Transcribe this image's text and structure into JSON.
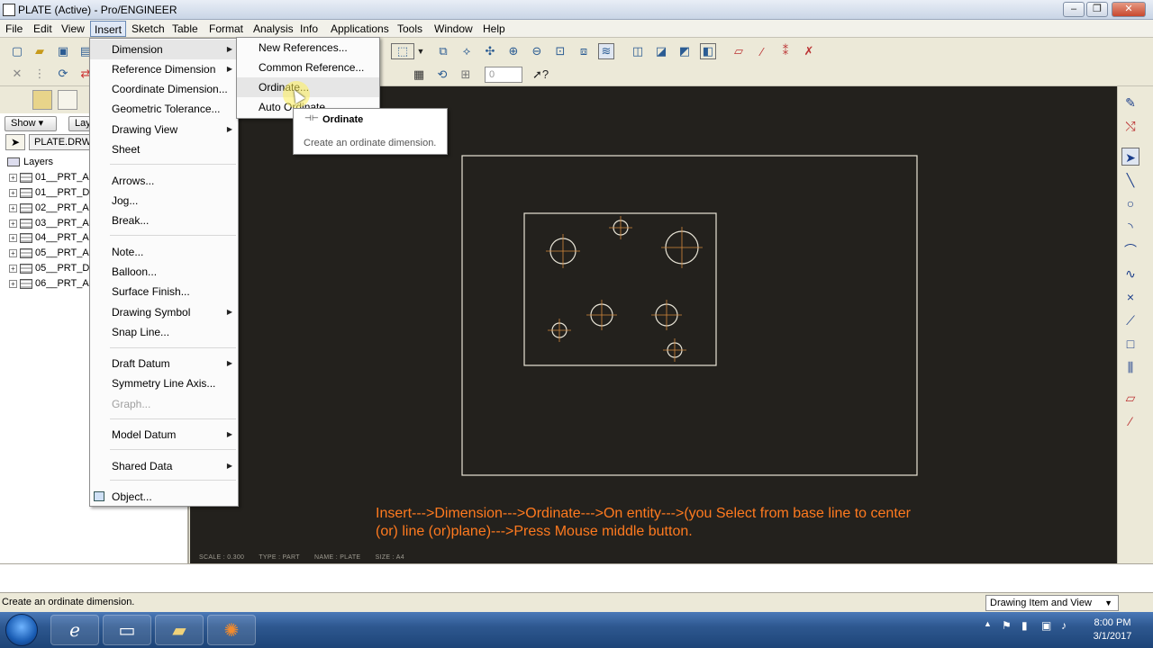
{
  "window": {
    "title": "PLATE (Active) - Pro/ENGINEER",
    "minimize": "–",
    "restore": "❐",
    "close": "✕"
  },
  "menubar": [
    "File",
    "Edit",
    "View",
    "Insert",
    "Sketch",
    "Table",
    "Format",
    "Analysis",
    "Info",
    "Applications",
    "Tools",
    "Window",
    "Help"
  ],
  "insert_menu": {
    "items": [
      {
        "label": "Dimension",
        "sub": true
      },
      {
        "label": "Reference Dimension",
        "sub": true
      },
      {
        "label": "Coordinate Dimension...",
        "sub": false
      },
      {
        "label": "Geometric Tolerance...",
        "sub": false
      },
      {
        "label": "Drawing View",
        "sub": true
      },
      {
        "label": "Sheet",
        "sub": false
      },
      {
        "label": "Arrows...",
        "sub": false
      },
      {
        "label": "Jog...",
        "sub": false
      },
      {
        "label": "Break...",
        "sub": false
      },
      {
        "label": "Note...",
        "sub": false
      },
      {
        "label": "Balloon...",
        "sub": false
      },
      {
        "label": "Surface Finish...",
        "sub": false
      },
      {
        "label": "Drawing Symbol",
        "sub": true
      },
      {
        "label": "Snap Line...",
        "sub": false
      },
      {
        "label": "Draft Datum",
        "sub": true
      },
      {
        "label": "Symmetry Line Axis...",
        "sub": false
      },
      {
        "label": "Graph...",
        "sub": false
      },
      {
        "label": "Model Datum",
        "sub": true
      },
      {
        "label": "Shared Data",
        "sub": true
      },
      {
        "label": "Object...",
        "sub": false
      }
    ]
  },
  "dimension_submenu": {
    "items": [
      "New References...",
      "Common Reference...",
      "Ordinate...",
      "Auto Ordinate"
    ]
  },
  "tooltip": {
    "icon": "—\n—12",
    "title": "Ordinate",
    "description": "Create an ordinate dimension."
  },
  "left_panel": {
    "show_button": "Show",
    "layer_button": "Lay",
    "selector_text": "PLATE.DRW",
    "root_label": "Layers",
    "layers": [
      "01__PRT_A",
      "01__PRT_D",
      "02__PRT_A",
      "03__PRT_A",
      "04__PRT_A",
      "05__PRT_A",
      "05__PRT_D",
      "06__PRT_A"
    ]
  },
  "toolbar": {
    "spinner_value": "0"
  },
  "canvas": {
    "instruction_line1": "Insert--->Dimension--->Ordinate--->On entity--->(you Select from base line to center",
    "instruction_line2": "(or) line (or)plane)--->Press Mouse middle button.",
    "scale": "SCALE : 0.300",
    "type": "TYPE : PART",
    "name": "NAME : PLATE",
    "size": "SIZE : A4",
    "line_color": "#e8e4d6",
    "center_mark_color": "#d4883c"
  },
  "status": {
    "message": "Create an ordinate dimension.",
    "filter_value": "Drawing Item and View"
  },
  "taskbar": {
    "time": "8:00 PM",
    "date": "3/1/2017"
  }
}
